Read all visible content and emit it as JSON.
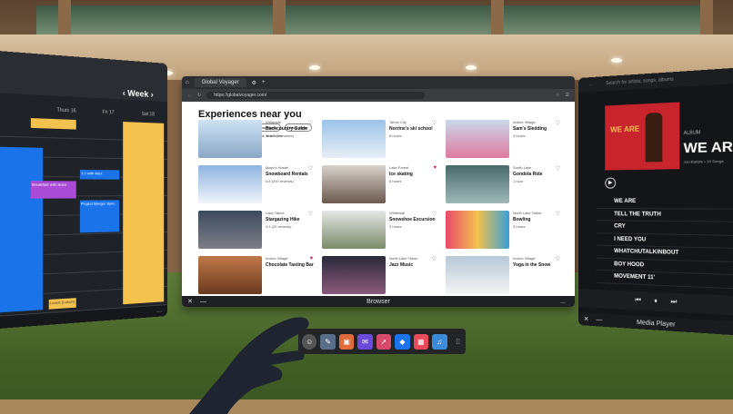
{
  "calendar": {
    "view_label": "Week",
    "days": [
      "Thurs 16",
      "Fri 17",
      "Sat 18"
    ],
    "events": [
      "Breakfast with team",
      "1:1 with Alex",
      "Project Merger Sync",
      "Lunch (Lunch)"
    ],
    "more_label": "..."
  },
  "browser": {
    "tab_title": "Global Voyager",
    "url": "https://globalvoyager.com/",
    "heading": "Experiences near you",
    "filters": [
      "Activity Type",
      "Time",
      "Instant Book",
      "More filters"
    ],
    "notice": "Review COVID-19 restrictions before you book. Learn more",
    "cards": [
      {
        "location": "Whitewall",
        "title": "Backcountry Guide",
        "meta": "★ 4.5 (2 reviews)"
      },
      {
        "location": "Tahoe City",
        "title": "Norrine's ski school",
        "meta": "8 hours"
      },
      {
        "location": "Incline Village",
        "title": "Sam's Sledding",
        "meta": "4 hours"
      },
      {
        "location": "Mayo's Hostel",
        "title": "Snowboard Rentals",
        "meta": "4.8 (200 reviews)"
      },
      {
        "location": "Lake Forest",
        "title": "Ice skating",
        "meta": "8 hours"
      },
      {
        "location": "South Lake",
        "title": "Gondola Ride",
        "meta": "1 hour"
      },
      {
        "location": "Lake Tahoe",
        "title": "Stargazing Hike",
        "meta": "4.4 (25 reviews)"
      },
      {
        "location": "Whitewall",
        "title": "Snowshoe Excursion",
        "meta": "3 hours"
      },
      {
        "location": "North Lake Tahoe",
        "title": "Bowling",
        "meta": "3 hours"
      },
      {
        "location": "Incline Village",
        "title": "Chocolate Tasting Bar",
        "meta": ""
      },
      {
        "location": "North Lake Tahoe",
        "title": "Jazz Music",
        "meta": ""
      },
      {
        "location": "Incline Village",
        "title": "Yoga in the Snow",
        "meta": ""
      }
    ],
    "footer_title": "Browser",
    "more_label": "..."
  },
  "media": {
    "search_placeholder": "Search for artists, songs, albums",
    "album_label": "ALBUM",
    "album_title": "WE AR",
    "cover_text": "WE ARE",
    "artist": "Jon Batiste • 10 Songs",
    "tracks": [
      "WE ARE",
      "TELL THE TRUTH",
      "CRY",
      "I NEED YOU",
      "WHATCHUTALKINBOUT",
      "BOY HOOD",
      "MOVEMENT 11'"
    ],
    "footer_title": "Media Player"
  },
  "colors": {
    "accent_blue": "#1a73e8",
    "calendar_yellow": "#f2c14e",
    "calendar_purple": "#a94bd6",
    "album_red": "#c8242e"
  }
}
